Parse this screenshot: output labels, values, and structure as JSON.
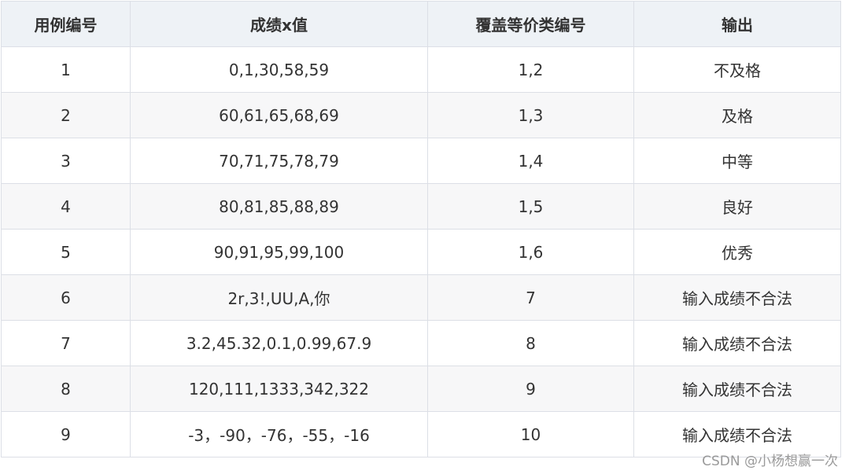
{
  "table": {
    "headers": [
      "用例编号",
      "成绩x值",
      "覆盖等价类编号",
      "输出"
    ],
    "rows": [
      [
        "1",
        "0,1,30,58,59",
        "1,2",
        "不及格"
      ],
      [
        "2",
        "60,61,65,68,69",
        "1,3",
        "及格"
      ],
      [
        "3",
        "70,71,75,78,79",
        "1,4",
        "中等"
      ],
      [
        "4",
        "80,81,85,88,89",
        "1,5",
        "良好"
      ],
      [
        "5",
        "90,91,95,99,100",
        "1,6",
        "优秀"
      ],
      [
        "6",
        "2r,3!,UU,A,你",
        "7",
        "输入成绩不合法"
      ],
      [
        "7",
        "3.2,45.32,0.1,0.99,67.9",
        "8",
        "输入成绩不合法"
      ],
      [
        "8",
        "120,111,1333,342,322",
        "9",
        "输入成绩不合法"
      ],
      [
        "9",
        "-3，-90，-76，-55，-16",
        "10",
        "输入成绩不合法"
      ]
    ]
  },
  "watermark": "CSDN @小杨想赢一次"
}
